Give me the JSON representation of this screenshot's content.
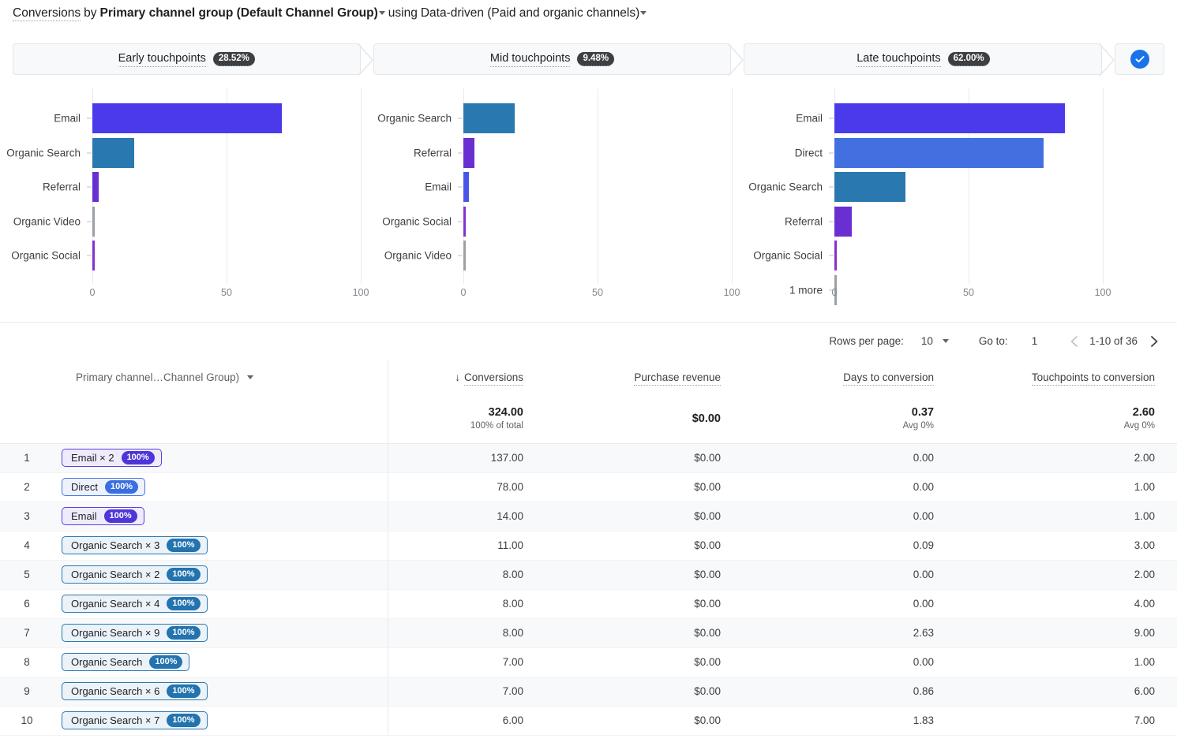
{
  "header": {
    "metric": "Conversions",
    "by_text": "by",
    "dimension": "Primary channel group (Default Channel Group)",
    "using_text": "using",
    "model": "Data-driven (Paid and organic channels)"
  },
  "tabs": [
    {
      "label": "Early touchpoints",
      "badge": "28.52%",
      "name": "tab-early-touchpoints"
    },
    {
      "label": "Mid touchpoints",
      "badge": "9.48%",
      "name": "tab-mid-touchpoints"
    },
    {
      "label": "Late touchpoints",
      "badge": "62.00%",
      "name": "tab-late-touchpoints"
    }
  ],
  "tab_done_icon": "check-circle-icon",
  "chart_data": [
    {
      "type": "bar",
      "title": "Early touchpoints",
      "orientation": "horizontal",
      "categories": [
        "Email",
        "Organic Search",
        "Referral",
        "Organic Video",
        "Organic Social"
      ],
      "values": [
        70.5,
        15.6,
        2.4,
        0.7,
        0.35
      ],
      "colors": [
        "#4A3AEA",
        "#2A78B0",
        "#6A2FD0",
        "#9AA0A6",
        "#8431CE"
      ],
      "xlabel": "",
      "ylabel": "",
      "xlim": [
        0,
        100
      ],
      "xticks": [
        0,
        50,
        100
      ],
      "xticklabels": [
        "0",
        "50",
        "100"
      ],
      "grid": true
    },
    {
      "type": "bar",
      "title": "Mid touchpoints",
      "orientation": "horizontal",
      "categories": [
        "Organic Search",
        "Referral",
        "Email",
        "Organic Social",
        "Organic Video"
      ],
      "values": [
        19.0,
        4.0,
        2.0,
        0.7,
        0.4
      ],
      "colors": [
        "#2A78B0",
        "#6A2FD0",
        "#4A55E8",
        "#8431CE",
        "#9AA0A6"
      ],
      "xlabel": "",
      "ylabel": "",
      "xlim": [
        0,
        100
      ],
      "xticks": [
        0,
        50,
        100
      ],
      "xticklabels": [
        "0",
        "50",
        "100"
      ],
      "grid": true
    },
    {
      "type": "bar",
      "title": "Late touchpoints",
      "orientation": "horizontal",
      "categories": [
        "Email",
        "Direct",
        "Organic Search",
        "Referral",
        "Organic Social",
        "1 more"
      ],
      "values": [
        86.0,
        78.0,
        26.5,
        6.5,
        0.9,
        0.8
      ],
      "colors": [
        "#4A3AEA",
        "#4270E0",
        "#2A78B0",
        "#6A2FD0",
        "#8431CE",
        "#9AA0A6"
      ],
      "xlabel": "",
      "ylabel": "",
      "xlim": [
        0,
        100
      ],
      "xticks": [
        0,
        50,
        100
      ],
      "xticklabels": [
        "0",
        "50",
        "100"
      ],
      "grid": true
    }
  ],
  "pagination": {
    "rows_per_page_label": "Rows per page:",
    "rows_per_page_value": "10",
    "goto_label": "Go to:",
    "goto_value": "1",
    "range": "1-10 of 36",
    "prev_icon": "chevron-left-icon",
    "next_icon": "chevron-right-icon"
  },
  "table": {
    "columns": [
      {
        "label": "Primary channel…Channel Group)",
        "align": "left"
      },
      {
        "label": "Conversions",
        "align": "right",
        "sorted": true,
        "sort_dir": "desc"
      },
      {
        "label": "Purchase revenue",
        "align": "right"
      },
      {
        "label": "Days to conversion",
        "align": "right"
      },
      {
        "label": "Touchpoints to conversion",
        "align": "right"
      }
    ],
    "totals": {
      "conversions": "324.00",
      "conversions_sub": "100% of total",
      "revenue": "$0.00",
      "revenue_sub": "",
      "days": "0.37",
      "days_sub": "Avg 0%",
      "touchpoints": "2.60",
      "touchpoints_sub": "Avg 0%"
    },
    "rows": [
      {
        "idx": "1",
        "chip_label": "Email × 2",
        "chip_pct": "100%",
        "chip_style": "email",
        "conversions": "137.00",
        "revenue": "$0.00",
        "days": "0.00",
        "touchpoints": "2.00"
      },
      {
        "idx": "2",
        "chip_label": "Direct",
        "chip_pct": "100%",
        "chip_style": "direct",
        "conversions": "78.00",
        "revenue": "$0.00",
        "days": "0.00",
        "touchpoints": "1.00"
      },
      {
        "idx": "3",
        "chip_label": "Email",
        "chip_pct": "100%",
        "chip_style": "email",
        "conversions": "14.00",
        "revenue": "$0.00",
        "days": "0.00",
        "touchpoints": "1.00"
      },
      {
        "idx": "4",
        "chip_label": "Organic Search × 3",
        "chip_pct": "100%",
        "chip_style": "search",
        "conversions": "11.00",
        "revenue": "$0.00",
        "days": "0.09",
        "touchpoints": "3.00"
      },
      {
        "idx": "5",
        "chip_label": "Organic Search × 2",
        "chip_pct": "100%",
        "chip_style": "search",
        "conversions": "8.00",
        "revenue": "$0.00",
        "days": "0.00",
        "touchpoints": "2.00"
      },
      {
        "idx": "6",
        "chip_label": "Organic Search × 4",
        "chip_pct": "100%",
        "chip_style": "search",
        "conversions": "8.00",
        "revenue": "$0.00",
        "days": "0.00",
        "touchpoints": "4.00"
      },
      {
        "idx": "7",
        "chip_label": "Organic Search × 9",
        "chip_pct": "100%",
        "chip_style": "search",
        "conversions": "8.00",
        "revenue": "$0.00",
        "days": "2.63",
        "touchpoints": "9.00"
      },
      {
        "idx": "8",
        "chip_label": "Organic Search",
        "chip_pct": "100%",
        "chip_style": "search",
        "conversions": "7.00",
        "revenue": "$0.00",
        "days": "0.00",
        "touchpoints": "1.00"
      },
      {
        "idx": "9",
        "chip_label": "Organic Search × 6",
        "chip_pct": "100%",
        "chip_style": "search",
        "conversions": "7.00",
        "revenue": "$0.00",
        "days": "0.86",
        "touchpoints": "6.00"
      },
      {
        "idx": "10",
        "chip_label": "Organic Search × 7",
        "chip_pct": "100%",
        "chip_style": "search",
        "conversions": "6.00",
        "revenue": "$0.00",
        "days": "1.83",
        "touchpoints": "7.00"
      }
    ]
  },
  "chip_styles": {
    "email": {
      "border": "#5B3FE0",
      "bg": "#EFEBFC",
      "badge": "#4D35D8"
    },
    "direct": {
      "border": "#4475E8",
      "bg": "#EDF2FD",
      "badge": "#3B6FE0"
    },
    "search": {
      "border": "#2A78B0",
      "bg": "#EBF3F8",
      "badge": "#2273AE"
    }
  },
  "accent_color": "#1a73e8"
}
